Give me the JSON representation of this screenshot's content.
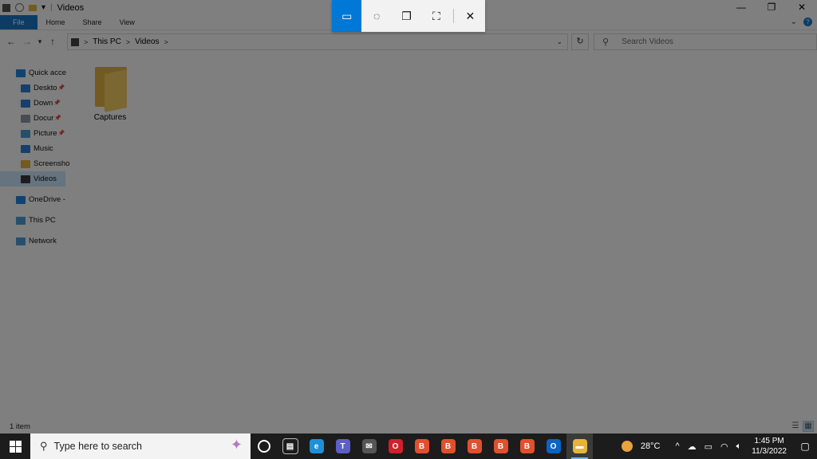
{
  "window": {
    "title": "Videos",
    "quick_access_arrow": "▾",
    "controls": {
      "minimize": "—",
      "restore": "❐",
      "close": "✕"
    }
  },
  "ribbon": {
    "tabs": [
      "File",
      "Home",
      "Share",
      "View"
    ],
    "expand": "⌄",
    "help": "?"
  },
  "address": {
    "back": "←",
    "forward": "→",
    "recent": "▾",
    "up": "↑",
    "crumbs": [
      "This PC",
      "Videos"
    ],
    "separator": ">",
    "dropdown": "⌄",
    "refresh": "↻"
  },
  "search": {
    "placeholder": "Search Videos"
  },
  "navpane": {
    "items": [
      {
        "label": "Quick acce",
        "icon": "star-icon",
        "color": "#1e88e5",
        "pin": ""
      },
      {
        "label": "Deskto",
        "icon": "desktop-icon",
        "color": "#2f7fd6",
        "pin": "📌"
      },
      {
        "label": "Down",
        "icon": "download-icon",
        "color": "#2f7fd6",
        "pin": "📌"
      },
      {
        "label": "Docur",
        "icon": "documents-icon",
        "color": "#8e9aa8",
        "pin": "📌"
      },
      {
        "label": "Picture",
        "icon": "pictures-icon",
        "color": "#4aa0d8",
        "pin": "📌"
      },
      {
        "label": "Music",
        "icon": "music-icon",
        "color": "#2f7fd6",
        "pin": ""
      },
      {
        "label": "Screensho",
        "icon": "folder-icon",
        "color": "#e6b43c",
        "pin": ""
      },
      {
        "label": "Videos",
        "icon": "videos-icon",
        "color": "#3b3b3b",
        "pin": ""
      },
      {
        "label": "OneDrive -",
        "icon": "onedrive-icon",
        "color": "#1e88e5",
        "pin": ""
      },
      {
        "label": "This PC",
        "icon": "this-pc-icon",
        "color": "#4aa0d8",
        "pin": ""
      },
      {
        "label": "Network",
        "icon": "network-icon",
        "color": "#4aa0d8",
        "pin": ""
      }
    ]
  },
  "content": {
    "folders": [
      {
        "name": "Captures"
      }
    ]
  },
  "status": {
    "count": "1 item"
  },
  "snip_toolbar": {
    "modes": [
      {
        "name": "rectangular-snip",
        "glyph": "▭",
        "active": true
      },
      {
        "name": "freeform-snip",
        "glyph": "◌",
        "active": false
      },
      {
        "name": "window-snip",
        "glyph": "❐",
        "active": false
      },
      {
        "name": "fullscreen-snip",
        "glyph": "⛶",
        "active": false
      }
    ],
    "close": "✕"
  },
  "taskbar": {
    "search_placeholder": "Type here to search",
    "apps": [
      {
        "name": "task-view",
        "glyph": "▤",
        "color": "#1c1c1c"
      },
      {
        "name": "edge",
        "glyph": "e",
        "color": "#1f8fd8"
      },
      {
        "name": "teams",
        "glyph": "T",
        "color": "#5b5fc7"
      },
      {
        "name": "mail",
        "glyph": "✉",
        "color": "#555555"
      },
      {
        "name": "opera",
        "glyph": "O",
        "color": "#d0202c"
      },
      {
        "name": "brave-1",
        "glyph": "B",
        "color": "#e0502d"
      },
      {
        "name": "brave-2",
        "glyph": "B",
        "color": "#e0502d"
      },
      {
        "name": "brave-3",
        "glyph": "B",
        "color": "#e0502d"
      },
      {
        "name": "brave-4",
        "glyph": "B",
        "color": "#e0502d"
      },
      {
        "name": "brave-5",
        "glyph": "B",
        "color": "#e0502d"
      },
      {
        "name": "outlook",
        "glyph": "O",
        "color": "#0a64c4"
      },
      {
        "name": "file-explorer",
        "glyph": "▬",
        "color": "#e6b43c",
        "active": true
      }
    ],
    "weather": "28°C",
    "tray_expand": "^",
    "time": "1:45 PM",
    "date": "11/3/2022"
  }
}
